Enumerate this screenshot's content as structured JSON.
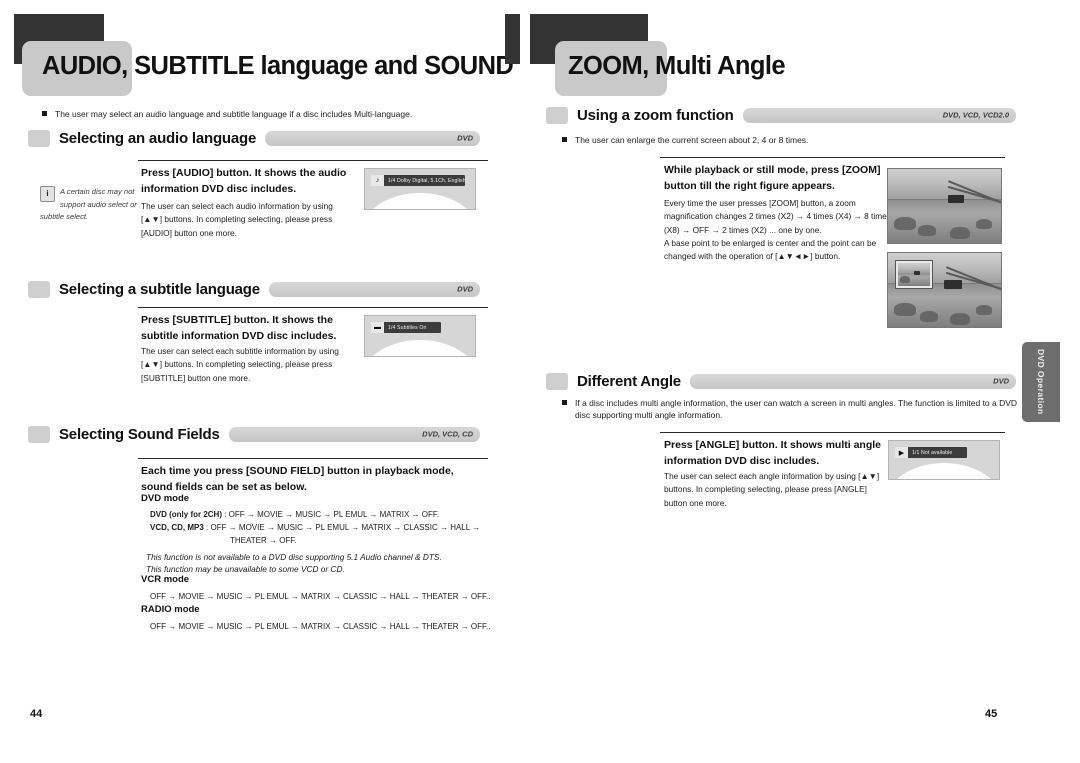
{
  "left_page": {
    "chapter_title": "AUDIO, SUBTITLE language and SOUND FIELDS",
    "page_number": "44",
    "intro_bullet": "The user may select an audio language and subtitle language if a disc includes Multi-language.",
    "sections": [
      {
        "label": "Selecting an audio language",
        "disc_types": "DVD",
        "heading": "Press [AUDIO] button. It shows the audio information DVD disc includes.",
        "body": "The user can select each audio information by using [▲▼] buttons. In completing selecting, please press [AUDIO] button one more.",
        "osd_text": "1/4 Dolby Digital, 5.1Ch,  English",
        "osd_icon": "speaker-icon",
        "note": "A certain disc may not support audio select or subtitle select."
      },
      {
        "label": "Selecting a subtitle language",
        "disc_types": "DVD",
        "heading": "Press [SUBTITLE] button. It shows the subtitle information DVD disc includes.",
        "body": "The user can select each subtitle information by using [▲▼] buttons. In completing selecting, please press [SUBTITLE] button one more.",
        "osd_text": "1/4 Subtitles On",
        "osd_icon": "subtitle-icon"
      },
      {
        "label": "Selecting Sound Fields",
        "disc_types": "DVD, VCD, CD",
        "heading": "Each time you press [SOUND FIELD] button in playback mode, sound fields can be set as below."
      }
    ],
    "sound_fields": {
      "dvd_mode_title": "DVD mode",
      "dvd_2ch_prefix": "DVD (only for 2CH)",
      "dvd_2ch_chain": " : OFF → MOVIE → MUSIC → PL EMUL →  MATRIX → OFF.",
      "vcd_prefix": "VCD, CD, MP3",
      "vcd_chain_line1": " : OFF → MOVIE → MUSIC → PL EMUL →  MATRIX → CLASSIC → HALL →",
      "vcd_chain_line2": "THEATER → OFF.",
      "note1": "This function is not available to a DVD disc supporting 5.1 Audio channel & DTS.",
      "note2": "This function may be unavailable to some VCD or CD.",
      "vcr_mode_title": "VCR mode",
      "vcr_chain": "OFF → MOVIE → MUSIC → PL EMUL →  MATRIX →  CLASSIC → HALL → THEATER → OFF..",
      "radio_mode_title": "RADIO mode",
      "radio_chain": "OFF → MOVIE → MUSIC → PL EMUL →  MATRIX →  CLASSIC → HALL → THEATER → OFF.."
    }
  },
  "right_page": {
    "chapter_title": "ZOOM, Multi Angle",
    "page_number": "45",
    "side_tab_label": "DVD Operation",
    "zoom_section": {
      "label": "Using a zoom function",
      "disc_types": "DVD, VCD, VCD2.0",
      "intro_bullet": "The user can enlarge the current screen about 2, 4 or 8 times.",
      "heading": "While playback or still mode, press [ZOOM] button till the right figure appears.",
      "body1": "Every time the user presses [ZOOM] button, a zoom magnification changes 2 times (X2) → 4 times (X4) → 8 times (X8) → OFF → 2 times (X2) ... one by one.",
      "body2": "A base point to be enlarged is center and the point can be changed with the operation of [▲▼◄►] button."
    },
    "angle_section": {
      "label": "Different Angle",
      "disc_types": "DVD",
      "intro_bullet": "If a disc includes multi angle information, the user can watch a screen in multi angles. The function is limited to a DVD disc supporting multi angle information.",
      "heading": "Press [ANGLE] button. It shows multi angle information DVD disc includes.",
      "body": "The user can select each angle information by using [▲▼] buttons. In completing selecting, please press [ANGLE] button one more.",
      "osd_text": "1/1 Not available",
      "osd_icon": "angle-icon"
    }
  },
  "colors": {
    "header_dark": "#333333",
    "header_light": "#c9c9c9",
    "bar_gray": "#cfcfcf",
    "side_tab": "#6e6e6e"
  }
}
